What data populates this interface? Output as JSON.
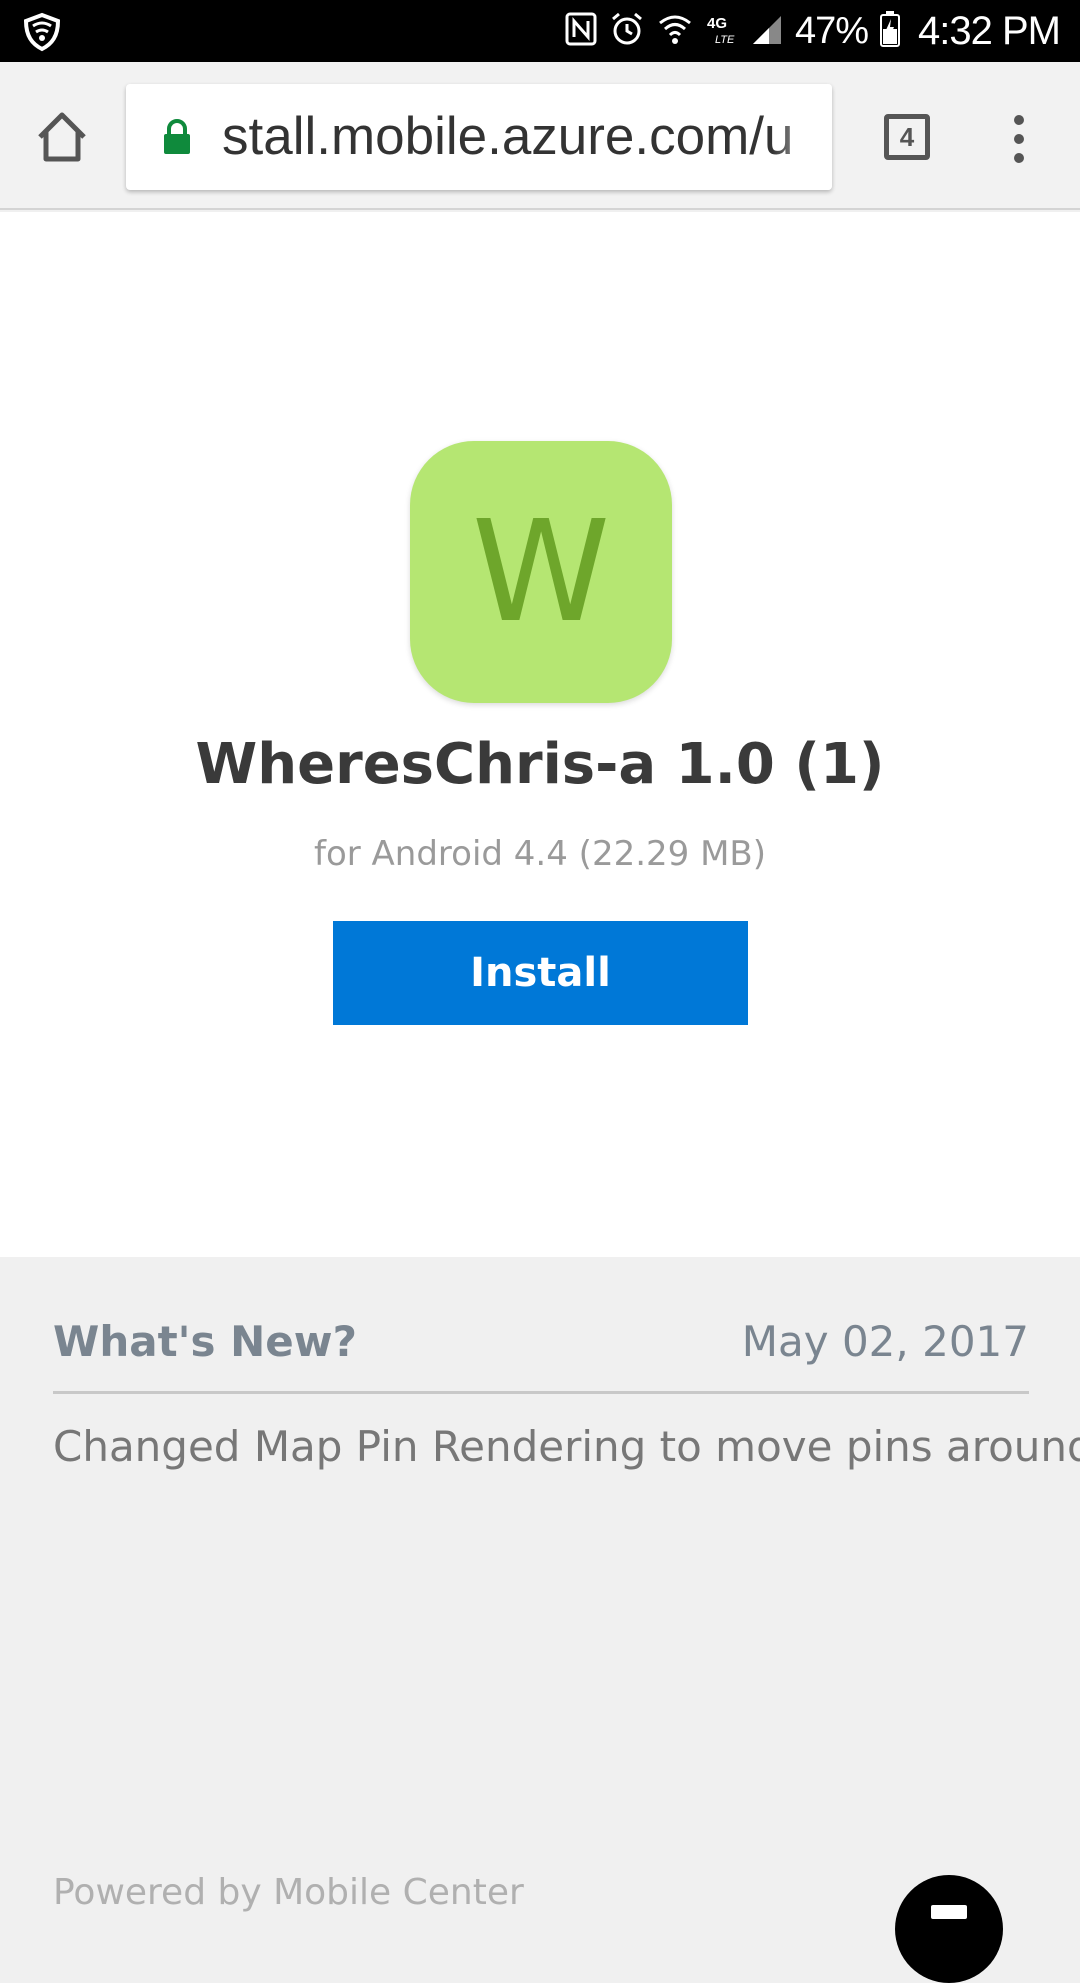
{
  "status_bar": {
    "battery_percent": "47%",
    "time": "4:32 PM",
    "icons": [
      "shield-icon",
      "nfc-icon",
      "alarm-icon",
      "wifi-icon",
      "4g-lte-icon",
      "signal-icon",
      "battery-icon"
    ]
  },
  "browser": {
    "url": "stall.mobile.azure.com/u",
    "tab_count": "4",
    "icons": [
      "home-icon",
      "lock-icon",
      "tabs-icon",
      "more-vert-icon"
    ]
  },
  "app": {
    "icon_letter": "W",
    "title": "WheresChris-a 1.0 (1)",
    "subtitle": "for Android 4.4 (22.29 MB)",
    "install_label": "Install"
  },
  "whats_new": {
    "title": "What's New?",
    "date": "May 02, 2017",
    "body": "Changed Map Pin Rendering to move pins around"
  },
  "footer": {
    "text": "Powered by Mobile Center"
  },
  "colors": {
    "install_button": "#0078d7",
    "app_icon_bg": "#b5e672",
    "app_icon_letter": "#6ea62b",
    "lock": "#0f8a3c"
  }
}
